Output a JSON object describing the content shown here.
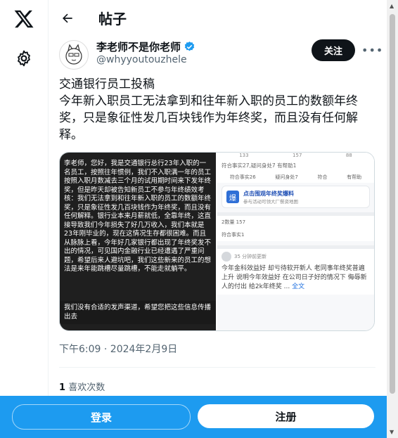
{
  "header": {
    "title": "帖子"
  },
  "author": {
    "name": "李老师不是你老师",
    "handle": "@whyyoutouzhele",
    "follow_label": "关注"
  },
  "post": {
    "lines": [
      "交通银行员工投稿",
      "今年新入职员工无法拿到和往年新入职的员工的数额年终奖，只是象征性发几百块钱作为年终奖，而且没有任何解释。"
    ],
    "timestamp": "下午6:09 · 2024年2月9日",
    "likes_count": "1",
    "likes_label": "喜欢次数"
  },
  "media_left": {
    "letter": "李老师，您好，我是交通银行总行23年入职的一名员工，按照往年惯例，我们不入职满一年的员工按照入职月数减去三个月的试用期时间来下发年终奖，但是昨天却被告知新员工不参与年终绩效考核：我们无法拿到和往年新入职的员工的数额年终奖，只是象征性发几百块钱作为年终奖，而且没有任何解释。银行业本来月薪就低，全靠年终，这直接导致我们今年损失了好几万收入，我们本就是23年刚毕业的，现在这情况生存都很困难。而且从脉脉上看，今年好几家银行都出现了年终奖发不出的情况，可见国内金融行业已经遭遇了严重问题，希望后来人避坑吧，我们这些新来的员工的想法是来年能跳槽尽量跳槽，不能走就躺平。",
    "bottom": "我们没有合适的发声渠道，希望您把这些信息传播出去"
  },
  "media_right": {
    "top_counts": [
      "133",
      "157",
      "88"
    ],
    "notice": "符合事实27,疑问身处7 有帮助1",
    "cats": [
      "符合事实26",
      "疑问身处7",
      "符合",
      "有帮助"
    ],
    "card_badge": "爆",
    "card_title": "点击围观年终奖爆料",
    "card_sub": "参与活动可领大厂餐资地图",
    "section_row": "符合事实1",
    "section_count": "2数量 157",
    "post_meta": "35 分钟前更新",
    "post_text": "今年金科效益好 却亏待软开新人 老同事年终奖普遍上升 说明今年效益好 在公司日子好的情况下 侮辱新人的付出 给2k年终奖 ...",
    "post_more": "全文"
  },
  "auth": {
    "login_label": "登录",
    "signup_label": "注册"
  },
  "colors": {
    "accent": "#1d9bf0",
    "text": "#0f1419",
    "muted": "#536471",
    "verified": "#1d9bf0"
  },
  "icons": [
    "x-logo-icon",
    "gear-icon",
    "back-arrow-icon",
    "verified-badge-icon",
    "more-icon"
  ]
}
